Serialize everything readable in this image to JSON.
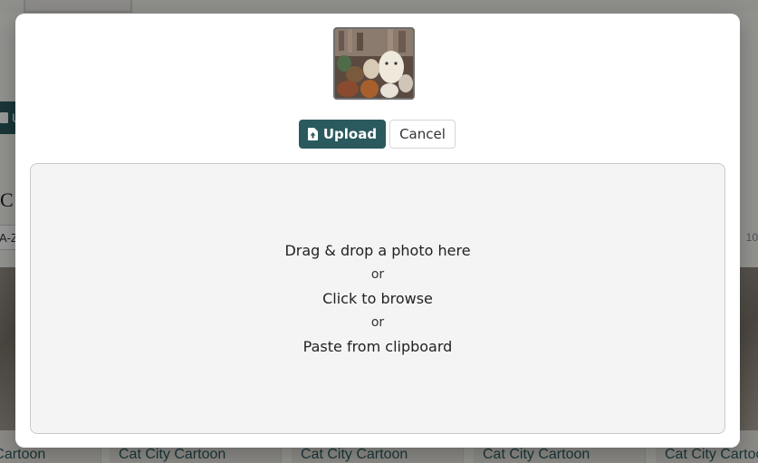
{
  "background": {
    "upload_label": "U",
    "heading": "C",
    "sort_value": "A-Z",
    "count_text": "10",
    "cards": [
      {
        "name": "Cat City Cartoon"
      },
      {
        "name": "Cat City Cartoon"
      },
      {
        "name": "Cat City Cartoon"
      },
      {
        "name": "Cat City Cartoon"
      },
      {
        "name": "Cat City Cartoon"
      }
    ]
  },
  "modal": {
    "preview_icon": "image-thumbnail",
    "buttons": {
      "upload_label": "Upload",
      "upload_icon": "file-upload-icon",
      "cancel_label": "Cancel"
    },
    "dropzone": {
      "drag_text": "Drag & drop a photo here",
      "or_1": "or",
      "browse_text": "Click to browse",
      "or_2": "or",
      "paste_text": "Paste from clipboard"
    }
  },
  "colors": {
    "primary": "#2b5a5e",
    "dropzone_bg": "#f4f4f4",
    "overlay": "rgba(0,0,0,0.40)"
  }
}
